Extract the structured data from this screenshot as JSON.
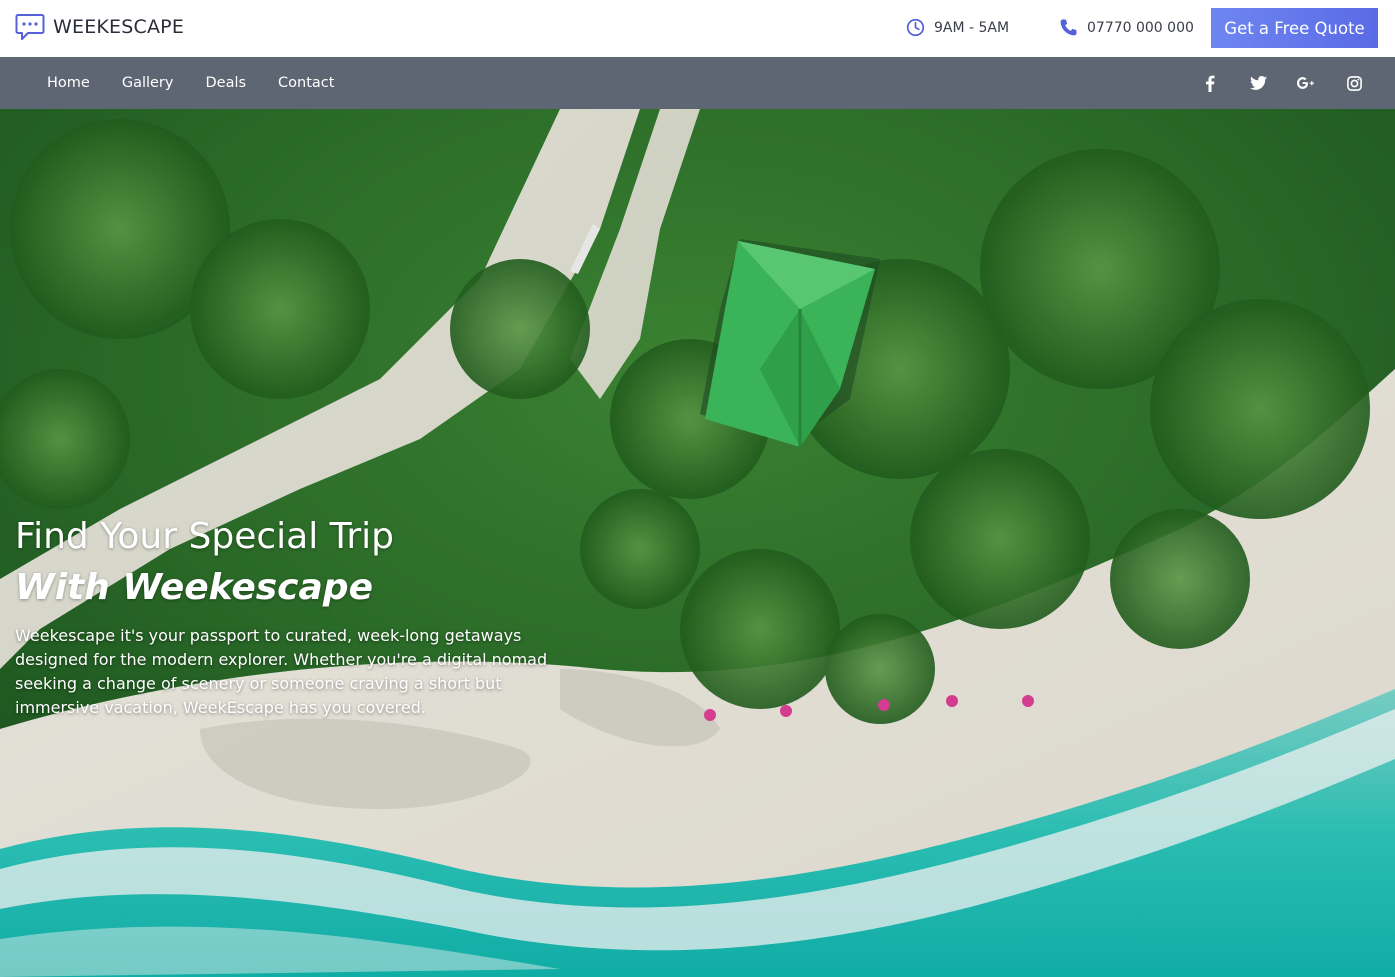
{
  "brand": {
    "name": "WEEKESCAPE",
    "icon": "chat-bubble-icon"
  },
  "header": {
    "hours": {
      "icon": "clock-icon",
      "text": "9AM - 5AM"
    },
    "phone": {
      "icon": "phone-icon",
      "text": "07770 000 000"
    },
    "quote_button": "Get a Free Quote"
  },
  "nav": {
    "links": [
      "Home",
      "Gallery",
      "Deals",
      "Contact"
    ],
    "social": [
      "facebook-icon",
      "twitter-icon",
      "google-plus-icon",
      "instagram-icon"
    ]
  },
  "hero": {
    "title_line1": "Find Your Special Trip",
    "title_line2": "With Weekescape",
    "description": "Weekescape it's your passport to curated, week-long getaways designed for the modern explorer. Whether you're a digital nomad seeking a change of scenery or someone craving a short but immersive vacation, WeekEscape has you covered."
  },
  "colors": {
    "accent": "#5f72ea",
    "navbar": "#5e6573",
    "icon": "#5561d8"
  }
}
